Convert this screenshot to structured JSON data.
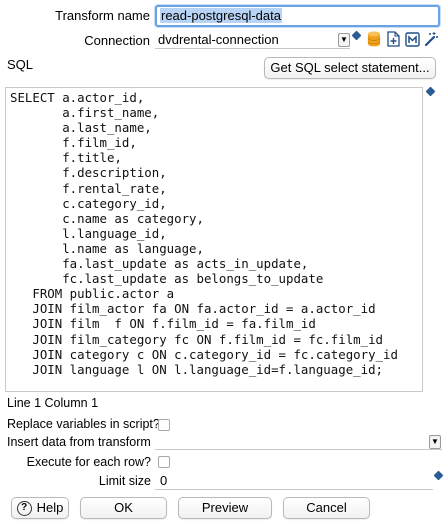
{
  "transform_name": {
    "label": "Transform name",
    "value": "read-postgresql-data"
  },
  "connection": {
    "label": "Connection",
    "value": "dvdrental-connection",
    "arrow": "▼"
  },
  "sql": {
    "label": "SQL",
    "get_select_button": "Get SQL select statement...",
    "statement": "SELECT a.actor_id,\n       a.first_name,\n       a.last_name,\n       f.film_id,\n       f.title,\n       f.description,\n       f.rental_rate,\n       c.category_id,\n       c.name as category,\n       l.language_id,\n       l.name as language,\n       fa.last_update as acts_in_update,\n       fc.last_update as belongs_to_update\n   FROM public.actor a\n   JOIN film_actor fa ON fa.actor_id = a.actor_id\n   JOIN film  f ON f.film_id = fa.film_id\n   JOIN film_category fc ON f.film_id = fc.film_id\n   JOIN category c ON c.category_id = fc.category_id\n   JOIN language l ON l.language_id=f.language_id;",
    "position": "Line 1 Column 1"
  },
  "options": {
    "replace_variables_label": "Replace variables in script?",
    "insert_data_label": "Insert data from transform",
    "insert_data_value": "",
    "insert_data_arrow": "▼",
    "execute_each_row_label": "Execute for each row?",
    "limit_size_label": "Limit size",
    "limit_size_value": "0"
  },
  "footer": {
    "help": "Help",
    "help_glyph": "?",
    "ok": "OK",
    "preview": "Preview",
    "cancel": "Cancel"
  },
  "icons": {
    "variable": "variable-diamond-icon",
    "database": "database-icon",
    "new_connection": "new-file-icon",
    "manage": "manage-icon",
    "wizard": "wizard-icon"
  },
  "colors": {
    "focus_border": "#6aa2e6",
    "selection": "#b7d3f5",
    "variable_diamond": "#2d5c94",
    "database_icon": "#f0a21c"
  }
}
